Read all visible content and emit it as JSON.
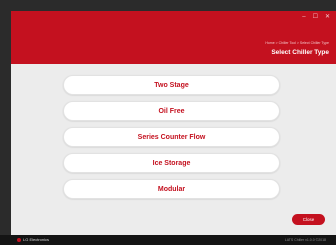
{
  "window": {
    "controls": [
      "–",
      "☐",
      "✕"
    ]
  },
  "header": {
    "breadcrumb": "Home > Chiller Tool > Select Chiller Type",
    "title": "Select Chiller Type"
  },
  "options": [
    {
      "label": "Two Stage"
    },
    {
      "label": "Oil Free"
    },
    {
      "label": "Series Counter Flow"
    },
    {
      "label": "Ice Storage"
    },
    {
      "label": "Modular"
    }
  ],
  "footer": {
    "close_label": "Close"
  },
  "taskbar": {
    "brand": "LG Electronics",
    "version": "LATS Chiller v1.0.0 ©2018"
  },
  "colors": {
    "accent": "#c4111f",
    "background": "#ececec",
    "taskbar": "#141414"
  }
}
